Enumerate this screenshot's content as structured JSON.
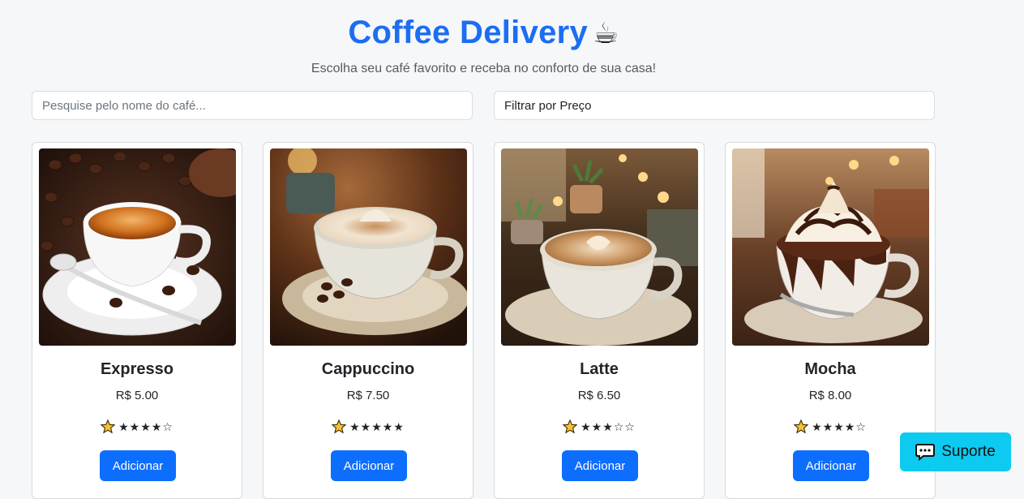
{
  "header": {
    "title": "Coffee Delivery",
    "subtitle": "Escolha seu café favorito e receba no conforto de sua casa!"
  },
  "search": {
    "placeholder": "Pesquise pelo nome do café...",
    "value": ""
  },
  "filter": {
    "label": "Filtrar por Preço"
  },
  "products": [
    {
      "name": "Expresso",
      "price": "R$ 5.00",
      "stars": "★★★★☆",
      "rating": 4,
      "button": "Adicionar"
    },
    {
      "name": "Cappuccino",
      "price": "R$ 7.50",
      "stars": "★★★★★",
      "rating": 5,
      "button": "Adicionar"
    },
    {
      "name": "Latte",
      "price": "R$ 6.50",
      "stars": "★★★☆☆",
      "rating": 3,
      "button": "Adicionar"
    },
    {
      "name": "Mocha",
      "price": "R$ 8.00",
      "stars": "★★★★☆",
      "rating": 4,
      "button": "Adicionar"
    }
  ],
  "support": {
    "label": "Suporte"
  },
  "colors": {
    "title": "#1b6ef3",
    "primary_button": "#0d6efd",
    "support_button": "#0dcaf0",
    "background": "#f6f7f9"
  },
  "icons": {
    "title": "hot-beverage-icon",
    "rating": "star-icon",
    "support": "speech-bubble-icon"
  }
}
